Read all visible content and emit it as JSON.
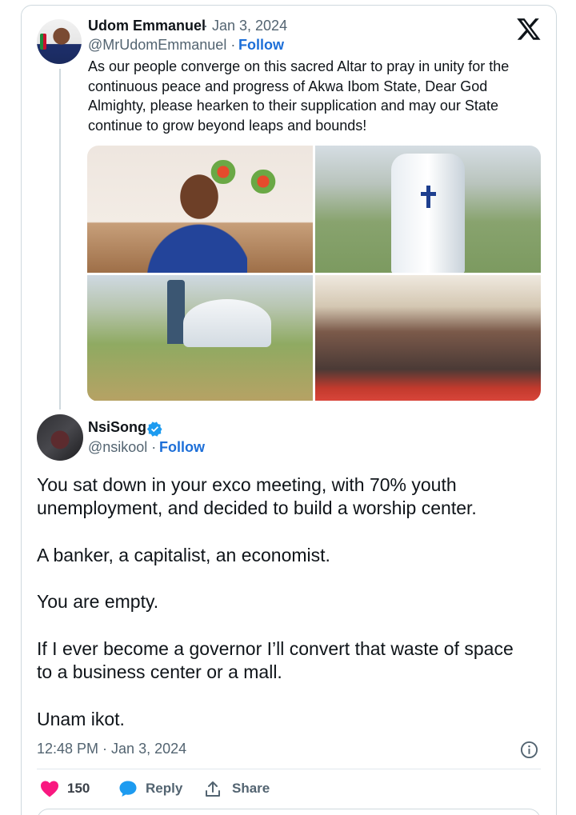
{
  "quoted_tweet": {
    "author_name": "Udom Emmanuel",
    "date": "· Jan 3, 2024",
    "handle": "@MrUdomEmmanuel ·",
    "follow_label": "Follow",
    "text": "As our people converge on this sacred Altar to pray in unity for the continuous peace and progress of Akwa Ibom State, Dear God Almighty, please hearken to their supplication and may our State continue to grow beyond leaps and bounds!",
    "images": [
      "speaker-photo",
      "aerial-church-photo",
      "aerial-worship-center-photo",
      "congregation-photo"
    ]
  },
  "tweet": {
    "author_name": "NsiSong",
    "handle": "@nsikool ·",
    "follow_label": "Follow",
    "paragraphs": [
      "You sat down in your exco meeting, with 70% youth unemployment, and decided to build a worship center.",
      "A banker, a capitalist, an economist.",
      "You are empty.",
      "If I ever become a governor I’ll convert that waste of space to a business center or a mall.",
      "Unam ikot."
    ],
    "timestamp": "12:48 PM · Jan 3, 2024"
  },
  "actions": {
    "likes": "150",
    "reply_label": "Reply",
    "share_label": "Share"
  },
  "colors": {
    "link_blue": "#1d6fd8",
    "verified_blue": "#1d9bf0",
    "heart_pink": "#f91880",
    "muted_text": "#536471"
  },
  "icons": [
    "x-logo-icon",
    "verified-badge-icon",
    "info-icon",
    "heart-icon",
    "reply-bubble-icon",
    "share-icon"
  ]
}
